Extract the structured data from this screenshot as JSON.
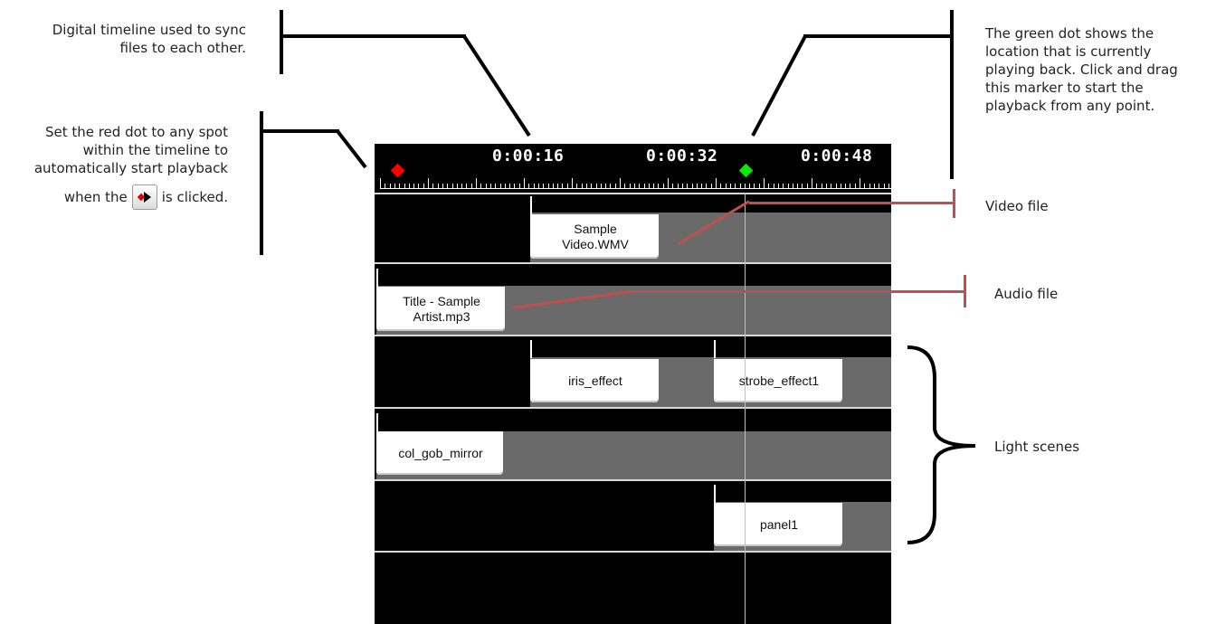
{
  "callouts": {
    "digital_timeline": "Digital timeline used to sync files to each other.",
    "red_dot_pre": "Set the red dot to any spot within the timeline to automatically start playback",
    "red_dot_when": "when the",
    "red_dot_post": "is clicked.",
    "green_dot": "The green dot shows the location that is currently playing back. Click and drag this marker to start the playback from any point.",
    "video_file": "Video file",
    "audio_file": "Audio file",
    "light_scenes": "Light scenes"
  },
  "ruler": {
    "time_labels": [
      "0:00:16",
      "0:00:32",
      "0:00:48"
    ],
    "start_marker_color": "#ff0000",
    "playhead_marker_color": "#00ee00"
  },
  "tracks": {
    "video": {
      "clip_label": "Sample Video.WMV"
    },
    "audio": {
      "clip_label": "Title - Sample Artist.mp3"
    },
    "light1": {
      "clip1_label": "iris_effect",
      "clip2_label": "strobe_effect1"
    },
    "light2": {
      "clip_label": "col_gob_mirror"
    },
    "light3": {
      "clip_label": "panel1"
    }
  },
  "icons": {
    "start_button": "go-to-start-marker-icon"
  }
}
